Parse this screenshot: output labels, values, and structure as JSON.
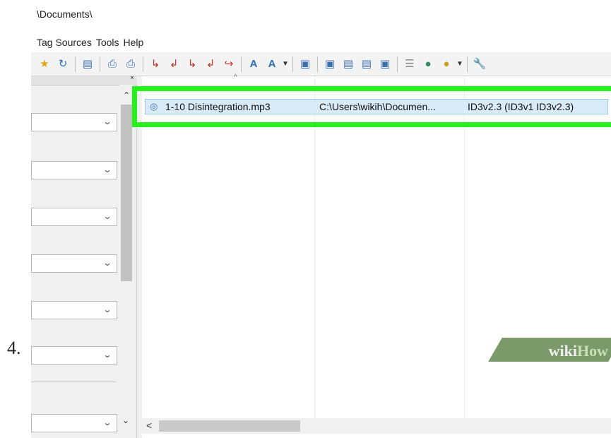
{
  "step": "4.",
  "window": {
    "title": "\\Documents\\"
  },
  "menu": [
    "Tag Sources",
    "Tools",
    "Help"
  ],
  "colors": {
    "highlight": "#27f01c",
    "selected_row": "#d9ebf9"
  },
  "file_list": {
    "rows": [
      {
        "icon": "mp3-file-icon",
        "filename": "1-10 Disintegration.mp3",
        "path": "C:\\Users\\wikih\\Documen...",
        "tag": "ID3v2.3 (ID3v1 ID3v2.3)"
      }
    ]
  },
  "watermark": {
    "part1": "wiki",
    "part2": "How"
  }
}
